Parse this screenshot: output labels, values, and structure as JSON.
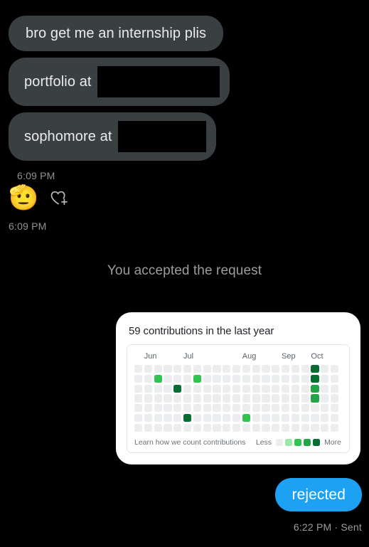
{
  "thread": {
    "incoming": {
      "messages": [
        {
          "text": "bro get me an internship plis",
          "redacted": false
        },
        {
          "text": "portfolio at",
          "redacted": true,
          "redact_width": 172
        },
        {
          "text": "sophomore at",
          "redacted": true,
          "redact_width": 124
        }
      ],
      "timestamp": "6:09 PM"
    },
    "reaction": {
      "emoji": "🫡",
      "emoji_name": "saluting-face",
      "add_icon": "heart-plus-icon",
      "timestamp": "6:09 PM"
    },
    "system_notice": "You accepted the request",
    "outgoing": {
      "text": "rejected",
      "timestamp": "6:22 PM · Sent",
      "bubble_color": "#1da1f2"
    }
  },
  "github_card": {
    "title": "59 contributions in the last year",
    "learn_more": "Learn how we count contributions",
    "legend_less": "Less",
    "legend_more": "More",
    "legend_colors": [
      "#ebedef",
      "#9be9a8",
      "#2ec44f",
      "#22a447",
      "#076d32"
    ],
    "months": [
      {
        "label": "Jun",
        "col": 1
      },
      {
        "label": "Jul",
        "col": 5
      },
      {
        "label": "Aug",
        "col": 11
      },
      {
        "label": "Sep",
        "col": 15
      },
      {
        "label": "Oct",
        "col": 18
      }
    ],
    "chart_data": {
      "type": "heatmap",
      "title": "59 contributions in the last year",
      "rows": 7,
      "cols": 21,
      "levels": [
        0,
        1,
        2,
        3,
        4
      ],
      "level_colors": [
        "#ebedef",
        "#9be9a8",
        "#2ec44f",
        "#22a447",
        "#076d32"
      ],
      "xlabel": "",
      "ylabel": "",
      "month_ticks": [
        "Jun",
        "Jul",
        "Aug",
        "Sep",
        "Oct"
      ],
      "total_contributions": 59,
      "grid": [
        [
          0,
          0,
          0,
          0,
          0,
          0,
          0,
          0,
          0,
          0,
          0,
          0,
          0,
          0,
          0,
          0,
          0,
          0,
          4,
          0,
          0
        ],
        [
          0,
          0,
          2,
          0,
          0,
          0,
          2,
          0,
          0,
          0,
          0,
          0,
          0,
          0,
          0,
          0,
          0,
          0,
          4,
          0,
          0
        ],
        [
          0,
          0,
          0,
          0,
          4,
          0,
          0,
          0,
          0,
          0,
          0,
          0,
          0,
          0,
          0,
          0,
          0,
          0,
          3,
          0,
          0
        ],
        [
          0,
          0,
          0,
          0,
          0,
          0,
          0,
          0,
          0,
          0,
          0,
          0,
          0,
          0,
          0,
          0,
          0,
          0,
          3,
          0,
          0
        ],
        [
          0,
          0,
          0,
          0,
          0,
          0,
          0,
          0,
          0,
          0,
          0,
          0,
          0,
          0,
          0,
          0,
          0,
          0,
          0,
          0,
          0
        ],
        [
          0,
          0,
          0,
          0,
          0,
          4,
          0,
          0,
          0,
          0,
          0,
          2,
          0,
          0,
          0,
          0,
          0,
          0,
          0,
          0,
          0
        ],
        [
          0,
          0,
          0,
          0,
          0,
          0,
          0,
          0,
          0,
          0,
          0,
          0,
          0,
          0,
          0,
          0,
          0,
          0,
          0,
          0,
          0
        ]
      ]
    }
  }
}
